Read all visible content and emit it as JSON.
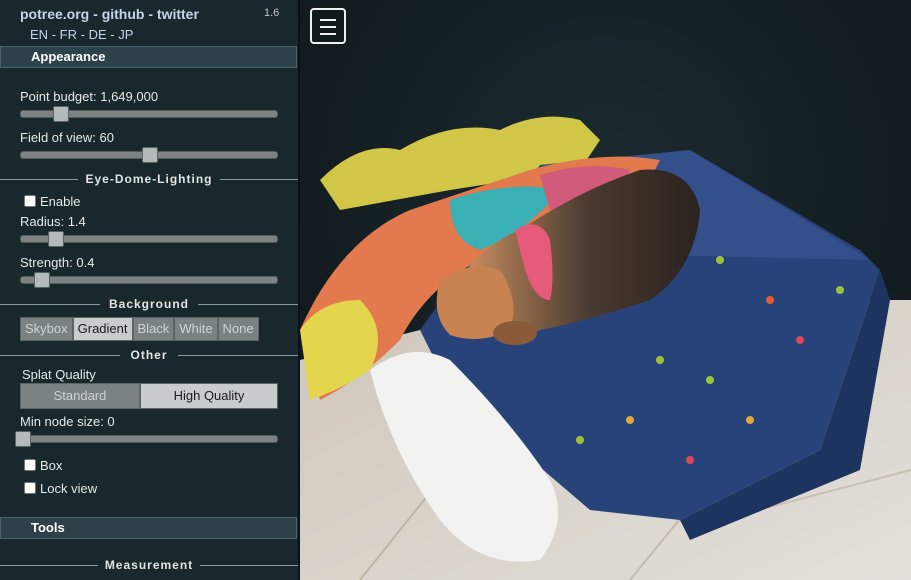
{
  "header": {
    "links": [
      "potree.org",
      "github",
      "twitter"
    ],
    "separator": "-",
    "version": "1.6",
    "languages": [
      "EN",
      "FR",
      "DE",
      "JP"
    ]
  },
  "appearance": {
    "title": "Appearance",
    "point_budget_label": "Point budget: 1,649,000",
    "point_budget": 1649000,
    "field_of_view_label": "Field of view: 60",
    "field_of_view": 60,
    "edl": {
      "title": "Eye-Dome-Lighting",
      "enable_label": "Enable",
      "radius_label": "Radius: 1.4",
      "radius": 1.4,
      "strength_label": "Strength: 0.4",
      "strength": 0.4
    },
    "background": {
      "title": "Background",
      "options": [
        "Skybox",
        "Gradient",
        "Black",
        "White",
        "None"
      ],
      "selected": "Gradient"
    },
    "other": {
      "title": "Other",
      "splat_quality_label": "Splat Quality",
      "splat_options": [
        "Standard",
        "High Quality"
      ],
      "splat_selected": "High Quality",
      "min_node_size_label": "Min node size: 0",
      "min_node_size": 0,
      "box_label": "Box",
      "lock_view_label": "Lock view"
    }
  },
  "tools": {
    "title": "Tools",
    "measurement_title": "Measurement"
  },
  "viewer": {
    "menu_icon": "hamburger-menu-icon",
    "scene": "point cloud of a beagle sleeping on a blue flowered cushion with a colorful pillow"
  },
  "colors": {
    "sidebar_bg": "#19282c",
    "link": "#c4d6e6",
    "viewer_bg": "#101a1e"
  }
}
